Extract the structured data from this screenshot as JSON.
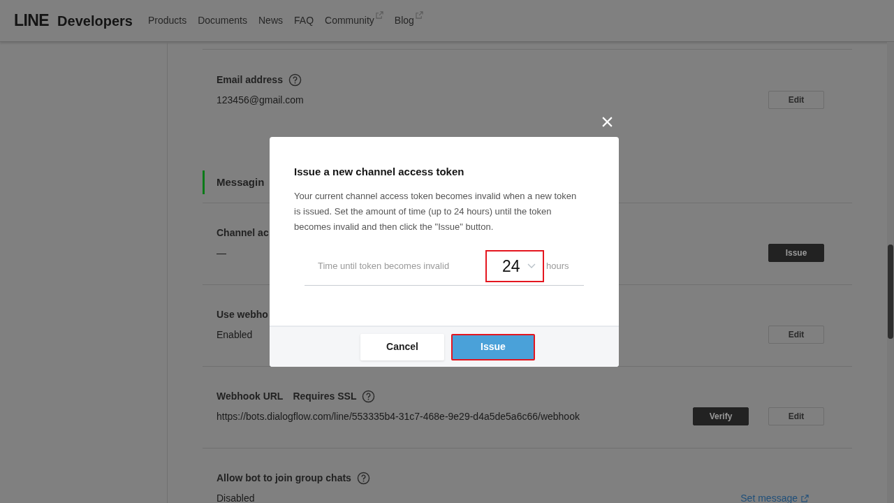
{
  "header": {
    "logo_bold": "LINE",
    "logo_text": "Developers",
    "nav": [
      {
        "label": "Products",
        "external": false
      },
      {
        "label": "Documents",
        "external": false
      },
      {
        "label": "News",
        "external": false
      },
      {
        "label": "FAQ",
        "external": false
      },
      {
        "label": "Community",
        "external": true
      },
      {
        "label": "Blog",
        "external": true
      }
    ]
  },
  "sections": [
    {
      "kind": "field",
      "label": "Email address",
      "help": true,
      "value": "123456@gmail.com",
      "buttons": [
        {
          "label": "Edit",
          "kind": "outline"
        }
      ]
    },
    {
      "kind": "heading",
      "label": "Messagin"
    },
    {
      "kind": "field",
      "label": "Channel ac",
      "help": false,
      "value": "—",
      "buttons": [
        {
          "label": "Issue",
          "kind": "dark"
        }
      ]
    },
    {
      "kind": "field",
      "label": "Use webho",
      "help": false,
      "value": "Enabled",
      "buttons": [
        {
          "label": "Edit",
          "kind": "outline"
        }
      ]
    },
    {
      "kind": "field",
      "label": "Webhook URL",
      "sublabel": "Requires SSL",
      "help": true,
      "value": "https://bots.dialogflow.com/line/553335b4-31c7-468e-9e29-d4a5de5a6c66/webhook",
      "buttons": [
        {
          "label": "Verify",
          "kind": "dark"
        },
        {
          "label": "Edit",
          "kind": "outline"
        }
      ]
    },
    {
      "kind": "field",
      "label": "Allow bot to join group chats",
      "help": true,
      "value": "Disabled",
      "link": "Set message"
    }
  ],
  "dialog": {
    "title": "Issue a new channel access token",
    "body": "Your current channel access token becomes invalid when a new token is issued. Set the amount of time (up to 24 hours) until the token becomes invalid and then click the \"Issue\" button.",
    "field_label": "Time until token becomes invalid",
    "value": "24",
    "unit": "hours",
    "highlighted": true,
    "buttons": [
      {
        "label": "Cancel",
        "kind": "secondary",
        "highlighted": false
      },
      {
        "label": "Issue",
        "kind": "primary",
        "highlighted": true
      }
    ]
  }
}
